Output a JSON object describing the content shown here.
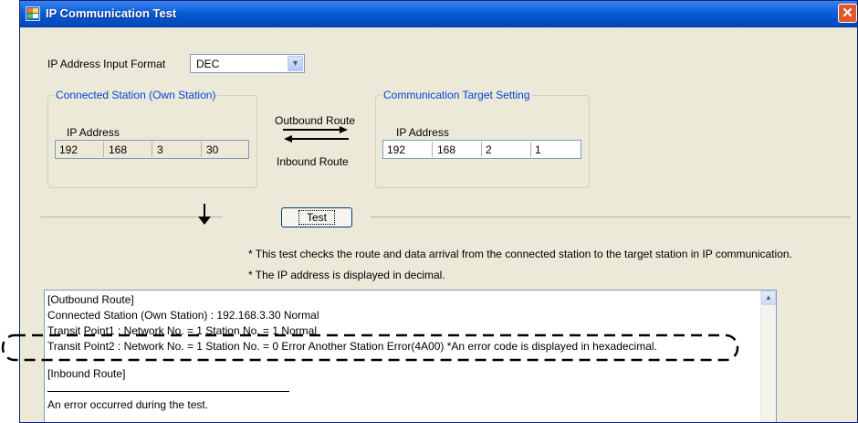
{
  "window": {
    "title": "IP Communication Test",
    "close_symbol": "✕"
  },
  "format": {
    "label": "IP Address Input Format",
    "value": "DEC",
    "dropdown_symbol": "▼"
  },
  "connected": {
    "legend": "Connected Station (Own Station)",
    "ip_label": "IP Address",
    "ip": [
      "192",
      "168",
      "3",
      "30"
    ]
  },
  "route": {
    "outbound": "Outbound Route",
    "inbound": "Inbound Route"
  },
  "target": {
    "legend": "Communication Target Setting",
    "ip_label": "IP Address",
    "ip": [
      "192",
      "168",
      "2",
      "1"
    ]
  },
  "test_button": "Test",
  "notes": [
    "* This test checks the route and data arrival from the connected station to the target station in IP communication.",
    "* The IP address is displayed in decimal."
  ],
  "result_lines": [
    "[Outbound Route]",
    "Connected Station (Own Station) : 192.168.3.30 Normal",
    "Transit Point1 : Network No. = 1 Station No. = 1 Normal",
    "Transit Point2 : Network No. = 1 Station No. = 0 Error Another Station Error(4A00) *An error code is displayed in hexadecimal.",
    "[Inbound Route]",
    "An error occurred during the test."
  ],
  "scroll_up_symbol": "▲"
}
